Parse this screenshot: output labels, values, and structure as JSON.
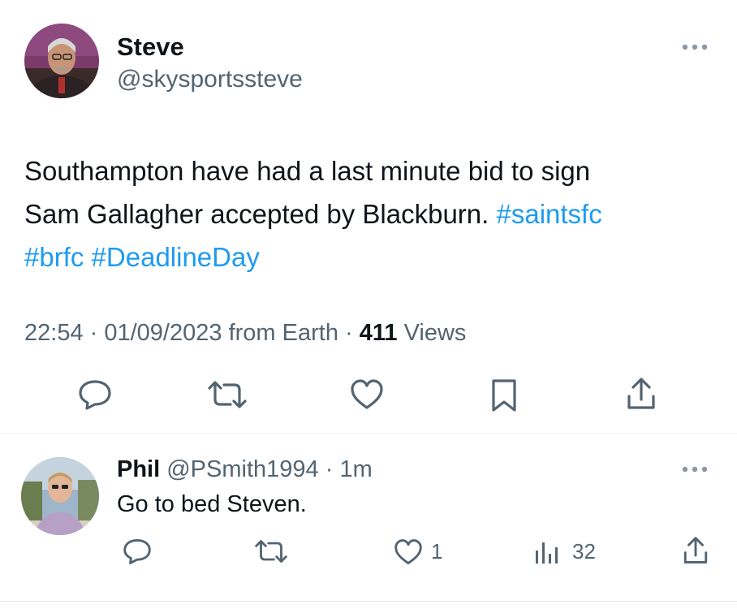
{
  "tweet": {
    "author_name": "Steve",
    "author_handle": "@skysportssteve",
    "text_line1": "Southampton have had a last minute bid to sign",
    "text_line2_plain": "Sam Gallagher accepted by Blackburn. ",
    "hashtag_saints": "#saintsfc",
    "hashtag_brfc": "#brfc",
    "hashtag_deadline": "#DeadlineDay",
    "time": "22:54",
    "sep1": " · ",
    "date": "01/09/2023",
    "from": " from Earth",
    "sep2": " · ",
    "views_count": "411",
    "views_label": " Views"
  },
  "reply": {
    "author_name": "Phil",
    "author_handle": "@PSmith1994",
    "sep": " · ",
    "time": "1m",
    "text": "Go to bed Steven.",
    "like_count": "1",
    "view_count": "32"
  },
  "colors": {
    "link": "#1d9bf0",
    "muted": "#536471",
    "text": "#0f1419"
  }
}
